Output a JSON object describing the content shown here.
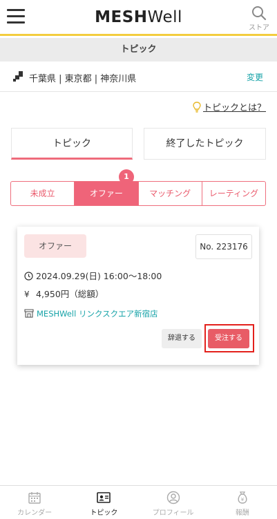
{
  "header": {
    "logo_bold": "MESH",
    "logo_light": "Well",
    "store_label": "ストア"
  },
  "subheader": {
    "title": "トピック"
  },
  "area": {
    "prefectures": "千葉県 | 東京都 | 神奈川県",
    "change_label": "変更"
  },
  "help": {
    "label": "トピックとは？"
  },
  "main_tabs": [
    {
      "label": "トピック",
      "active": true
    },
    {
      "label": "終了したトピック",
      "active": false
    }
  ],
  "status_tabs": [
    {
      "label": "未成立",
      "active": false
    },
    {
      "label": "オファー",
      "active": true
    },
    {
      "label": "マッチング",
      "active": false
    },
    {
      "label": "レーティング",
      "active": false
    }
  ],
  "offer_badge": "1",
  "card": {
    "status": "オファー",
    "number": "No. 223176",
    "datetime": "2024.09.29(日) 16:00〜18:00",
    "yen_symbol": "¥",
    "price": "4,950円（総額）",
    "shop": "MESHWell リンクスクエア新宿店",
    "decline_label": "辞退する",
    "accept_label": "受注する"
  },
  "bottom_nav": [
    {
      "label": "カレンダー",
      "icon": "calendar-icon",
      "active": false
    },
    {
      "label": "トピック",
      "icon": "topic-card-icon",
      "active": true
    },
    {
      "label": "プロフィール",
      "icon": "profile-icon",
      "active": false
    },
    {
      "label": "報酬",
      "icon": "money-bag-icon",
      "active": false
    }
  ],
  "colors": {
    "accent_pink": "#ef6479",
    "header_rule": "#f3cd3e",
    "link_teal": "#17a3a8",
    "accept_button": "#e85c66",
    "highlight_border": "#e3201b"
  }
}
